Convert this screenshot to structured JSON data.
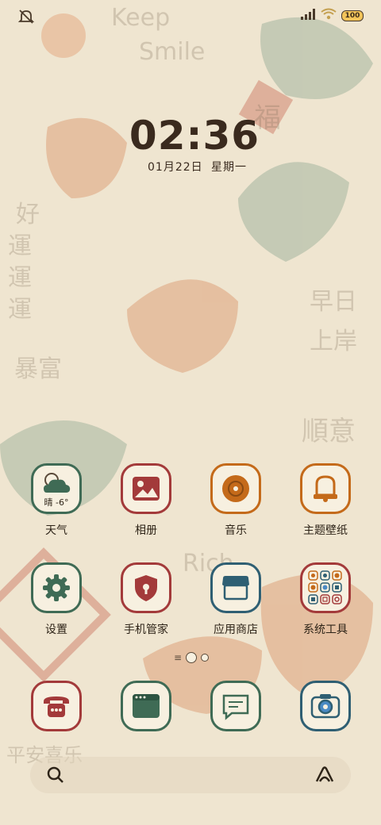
{
  "status_bar": {
    "left_icon": "mute-icon",
    "right_icons": [
      "signal-icon",
      "wifi-icon"
    ],
    "battery": "100"
  },
  "clock": {
    "time": "02:36",
    "date": "01月22日",
    "weekday": "星期一"
  },
  "apps": {
    "row1": [
      {
        "label": "天气",
        "icon": "weather-icon",
        "overlay": "晴 -6°",
        "color": "#3f6b55"
      },
      {
        "label": "相册",
        "icon": "gallery-icon",
        "color": "#a33a3a"
      },
      {
        "label": "音乐",
        "icon": "music-icon",
        "color": "#c46a1a"
      },
      {
        "label": "主题壁纸",
        "icon": "theme-icon",
        "color": "#c46a1a"
      }
    ],
    "row2": [
      {
        "label": "设置",
        "icon": "settings-icon",
        "color": "#3f6b55"
      },
      {
        "label": "手机管家",
        "icon": "shield-icon",
        "color": "#a33a3a"
      },
      {
        "label": "应用商店",
        "icon": "store-icon",
        "color": "#2f5f73"
      },
      {
        "label": "系统工具",
        "icon": "tools-folder-icon",
        "color": "#a33a3a"
      }
    ],
    "dock": [
      {
        "icon": "phone-icon",
        "color": "#a33a3a"
      },
      {
        "icon": "browser-icon",
        "color": "#3f6b55"
      },
      {
        "icon": "messages-icon",
        "color": "#3f6b55"
      },
      {
        "icon": "camera-icon",
        "color": "#2f5f73"
      }
    ]
  },
  "search_bar": {
    "left_icon": "search-icon",
    "right_icon": "assistant-icon"
  }
}
